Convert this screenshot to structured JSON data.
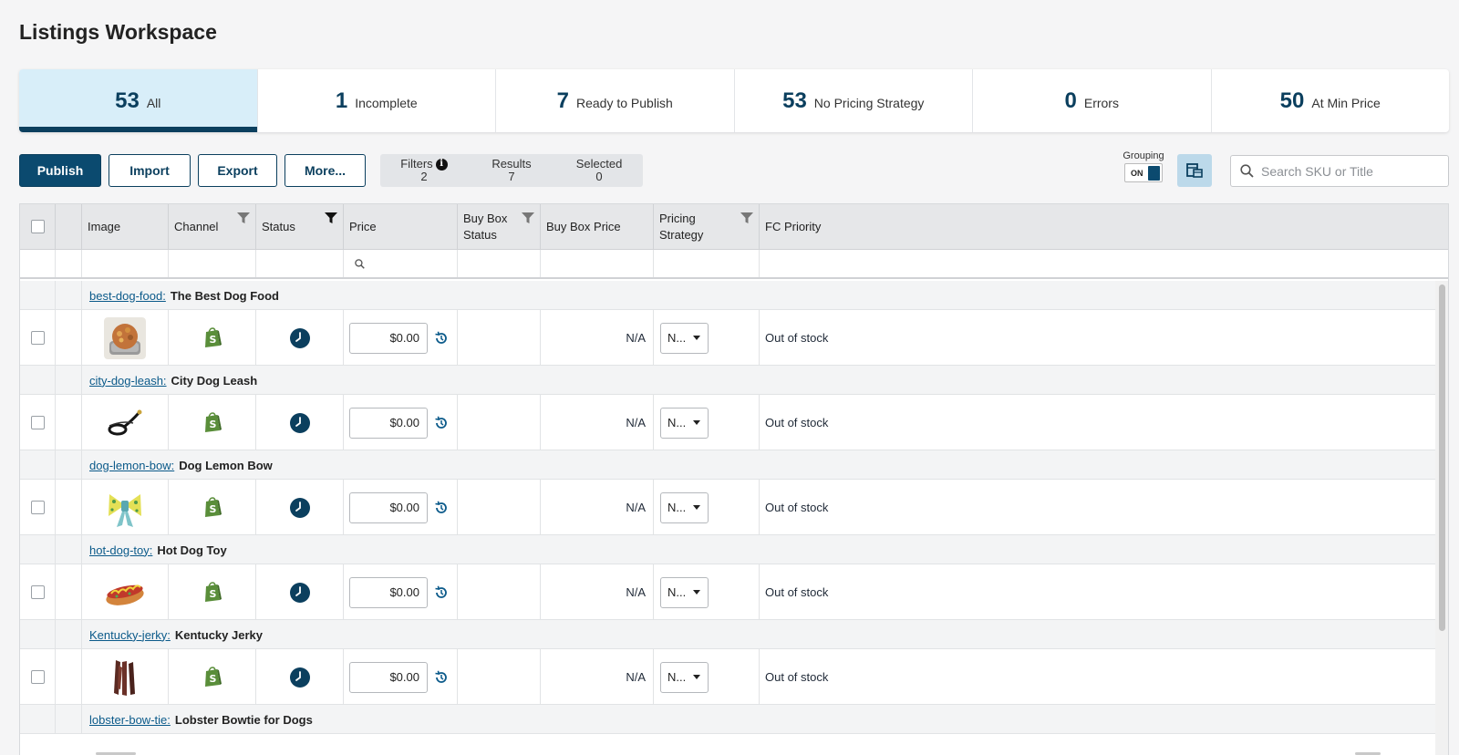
{
  "page": {
    "title": "Listings Workspace"
  },
  "tiles": [
    {
      "count": "53",
      "label": "All",
      "active": true
    },
    {
      "count": "1",
      "label": "Incomplete"
    },
    {
      "count": "7",
      "label": "Ready to Publish"
    },
    {
      "count": "53",
      "label": "No Pricing Strategy"
    },
    {
      "count": "0",
      "label": "Errors"
    },
    {
      "count": "50",
      "label": "At Min Price"
    }
  ],
  "toolbar": {
    "publish": "Publish",
    "import": "Import",
    "export": "Export",
    "more": "More...",
    "filters_label": "Filters",
    "filters_count": "2",
    "results_label": "Results",
    "results_count": "7",
    "selected_label": "Selected",
    "selected_count": "0",
    "grouping_label": "Grouping",
    "grouping_state": "ON",
    "search_placeholder": "Search SKU or Title"
  },
  "columns": {
    "image": "Image",
    "channel": "Channel",
    "status": "Status",
    "price": "Price",
    "buy_box_status": "Buy Box Status",
    "buy_box_price": "Buy Box Price",
    "pricing_strategy": "Pricing Strategy",
    "fc_priority": "FC Priority"
  },
  "listings": [
    {
      "sku": "best-dog-food:",
      "title": "The Best Dog Food",
      "price": "$0.00",
      "buy_box_price": "N/A",
      "strategy": "N...",
      "fc_priority": "Out of stock",
      "thumb": "food"
    },
    {
      "sku": "city-dog-leash:",
      "title": "City Dog Leash",
      "price": "$0.00",
      "buy_box_price": "N/A",
      "strategy": "N...",
      "fc_priority": "Out of stock",
      "thumb": "leash"
    },
    {
      "sku": "dog-lemon-bow:",
      "title": "Dog Lemon Bow",
      "price": "$0.00",
      "buy_box_price": "N/A",
      "strategy": "N...",
      "fc_priority": "Out of stock",
      "thumb": "bow"
    },
    {
      "sku": "hot-dog-toy:",
      "title": "Hot Dog Toy",
      "price": "$0.00",
      "buy_box_price": "N/A",
      "strategy": "N...",
      "fc_priority": "Out of stock",
      "thumb": "hotdog"
    },
    {
      "sku": "Kentucky-jerky:",
      "title": "Kentucky Jerky",
      "price": "$0.00",
      "buy_box_price": "N/A",
      "strategy": "N...",
      "fc_priority": "Out of stock",
      "thumb": "jerky"
    },
    {
      "sku": "lobster-bow-tie:",
      "title": "Lobster Bowtie for Dogs"
    }
  ],
  "colors": {
    "brand": "#0b4a6f",
    "active_tile": "#d8eef9",
    "shopify_green": "#5a8e3a"
  }
}
